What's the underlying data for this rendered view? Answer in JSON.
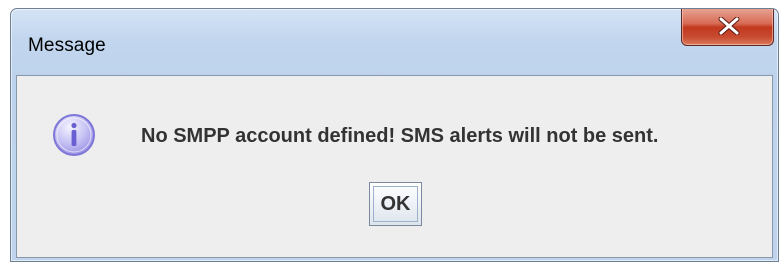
{
  "window": {
    "title": "Message"
  },
  "message": {
    "text": "No SMPP account defined! SMS alerts will not be sent.",
    "icon": "info-icon"
  },
  "buttons": {
    "ok_label": "OK",
    "close_icon": "close-icon"
  },
  "colors": {
    "close_button": "#c8452b",
    "title_bar": "#c2d6ee",
    "client_background": "#eeeeee",
    "info_icon": "#8f86e0"
  }
}
